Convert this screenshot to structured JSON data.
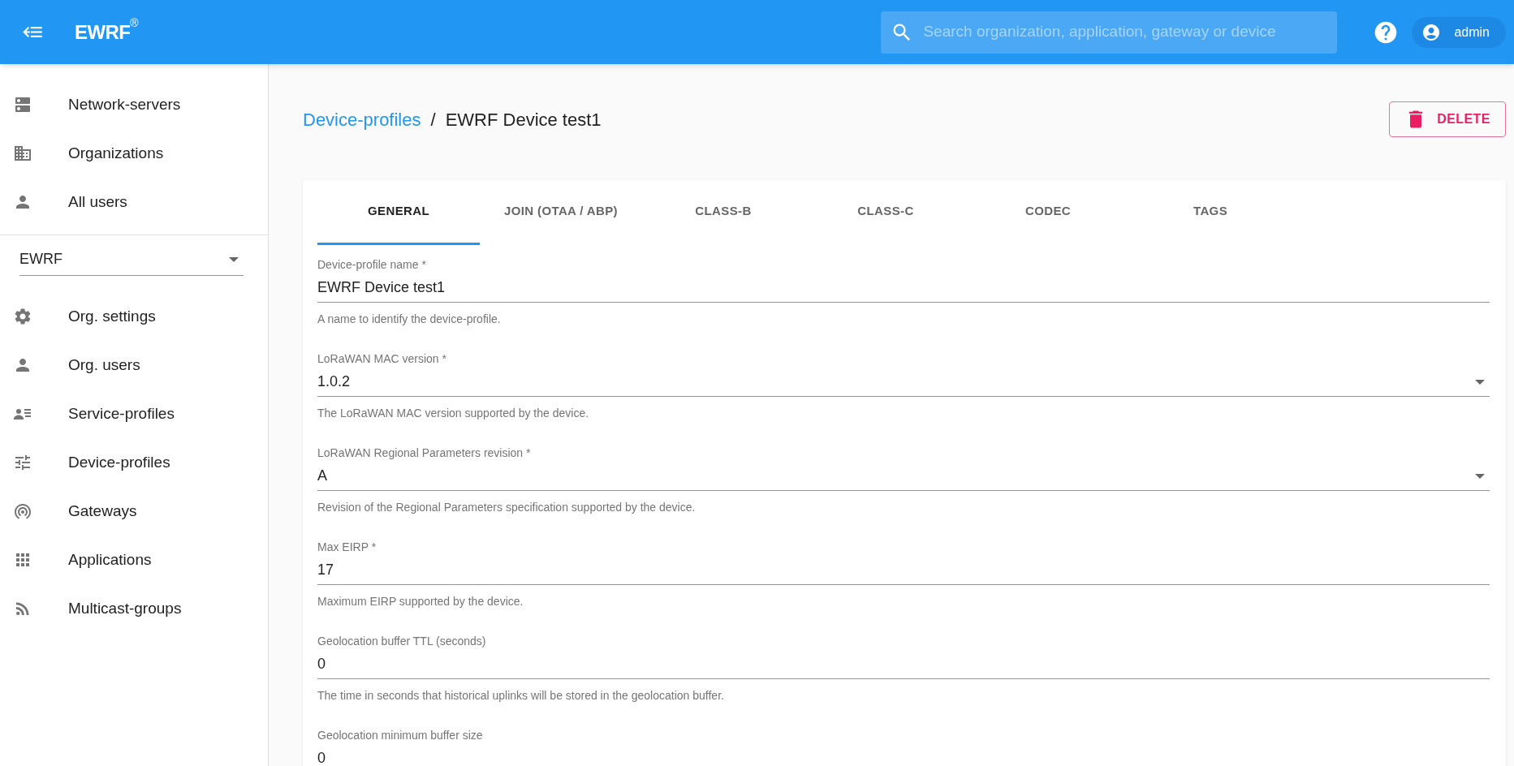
{
  "header": {
    "logo": {
      "text": "EWRF",
      "mark": "®"
    },
    "search": {
      "placeholder": "Search organization, application, gateway or device"
    },
    "user": "admin"
  },
  "sidebar": {
    "top_items": [
      {
        "label": "Network-servers"
      },
      {
        "label": "Organizations"
      },
      {
        "label": "All users"
      }
    ],
    "organization_select": {
      "value": "EWRF"
    },
    "org_items": [
      {
        "label": "Org. settings"
      },
      {
        "label": "Org. users"
      },
      {
        "label": "Service-profiles"
      },
      {
        "label": "Device-profiles"
      },
      {
        "label": "Gateways"
      },
      {
        "label": "Applications"
      },
      {
        "label": "Multicast-groups"
      }
    ]
  },
  "breadcrumb": {
    "link": "Device-profiles",
    "separator": "/",
    "current": "EWRF Device test1"
  },
  "delete_button": "DELETE",
  "tabs": [
    {
      "label": "GENERAL",
      "selected": true
    },
    {
      "label": "JOIN (OTAA / ABP)",
      "selected": false
    },
    {
      "label": "CLASS-B",
      "selected": false
    },
    {
      "label": "CLASS-C",
      "selected": false
    },
    {
      "label": "CODEC",
      "selected": false
    },
    {
      "label": "TAGS",
      "selected": false
    }
  ],
  "fields": [
    {
      "kind": "text",
      "label": "Device-profile name *",
      "value": "EWRF Device test1",
      "helper": "A name to identify the device-profile."
    },
    {
      "kind": "select",
      "label": "LoRaWAN MAC version *",
      "value": "1.0.2",
      "helper": "The LoRaWAN MAC version supported by the device."
    },
    {
      "kind": "select",
      "label": "LoRaWAN Regional Parameters revision *",
      "value": "A",
      "helper": "Revision of the Regional Parameters specification supported by the device."
    },
    {
      "kind": "text",
      "label": "Max EIRP *",
      "value": "17",
      "helper": "Maximum EIRP supported by the device."
    },
    {
      "kind": "text",
      "label": "Geolocation buffer TTL (seconds)",
      "value": "0",
      "helper": "The time in seconds that historical uplinks will be stored in the geolocation buffer."
    },
    {
      "kind": "text",
      "label": "Geolocation minimum buffer size",
      "value": "0"
    }
  ]
}
